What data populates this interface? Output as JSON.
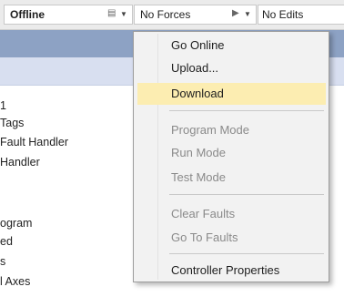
{
  "statusbar": {
    "mode_label": "Offline",
    "forces_label": "No Forces",
    "edits_label": "No Edits"
  },
  "tree": {
    "items": [
      "1",
      "Tags",
      "Fault Handler",
      "Handler",
      "ogram",
      "ed",
      "s",
      "l Axes"
    ]
  },
  "menu": {
    "items": [
      {
        "label": "Go Online",
        "enabled": true
      },
      {
        "label": "Upload...",
        "enabled": true
      },
      {
        "label": "Download",
        "enabled": true,
        "highlighted": true
      },
      {
        "label": "Program Mode",
        "enabled": false
      },
      {
        "label": "Run Mode",
        "enabled": false
      },
      {
        "label": "Test Mode",
        "enabled": false
      },
      {
        "label": "Clear Faults",
        "enabled": false
      },
      {
        "label": "Go To Faults",
        "enabled": false
      },
      {
        "label": "Controller Properties",
        "enabled": true
      }
    ]
  },
  "colors": {
    "highlight": "#fcedb1",
    "band_dark": "#8da2c4",
    "band_light": "#d8dff0"
  }
}
